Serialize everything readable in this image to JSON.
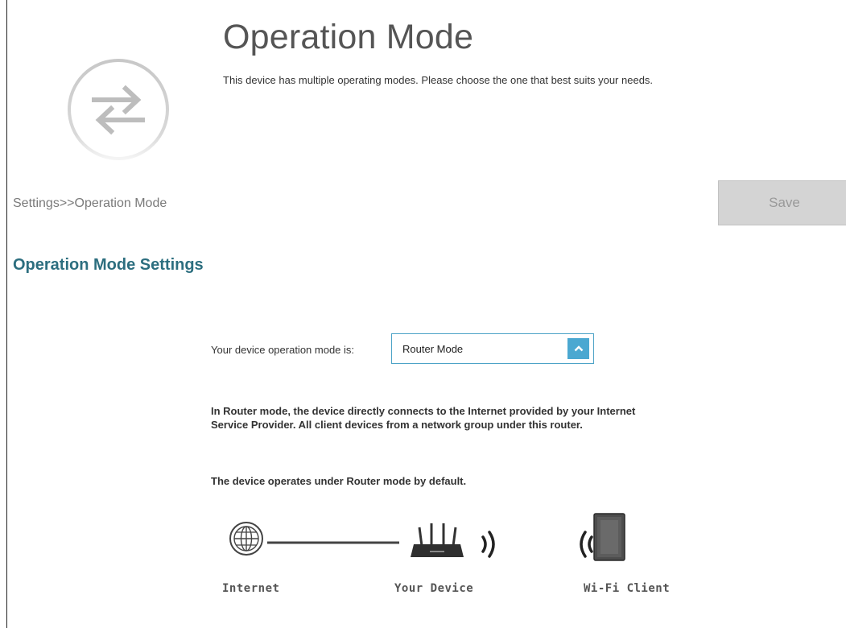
{
  "header": {
    "title": "Operation Mode",
    "description": "This device has multiple operating modes. Please choose the one that best suits your needs.",
    "icon": "swap-arrows-icon"
  },
  "breadcrumb": "Settings>>Operation Mode",
  "toolbar": {
    "save_label": "Save"
  },
  "section": {
    "title": "Operation Mode Settings",
    "mode_label": "Your device operation mode is:",
    "mode_value": "Router Mode",
    "description": "In Router mode, the device directly connects to the Internet provided by your Internet Service Provider. All client devices from a network group under this router.",
    "default_note": "The device operates under Router mode by default."
  },
  "diagram": {
    "internet_label": "Internet",
    "device_label": "Your Device",
    "client_label": "Wi-Fi Client",
    "icons": [
      "globe-icon",
      "router-icon",
      "wifi-signal-icon",
      "tablet-icon"
    ]
  },
  "colors": {
    "section_title": "#2c6e7f",
    "select_border": "#4da3c7",
    "select_button": "#4ba8d1",
    "save_button_bg": "#d4d4d4"
  }
}
